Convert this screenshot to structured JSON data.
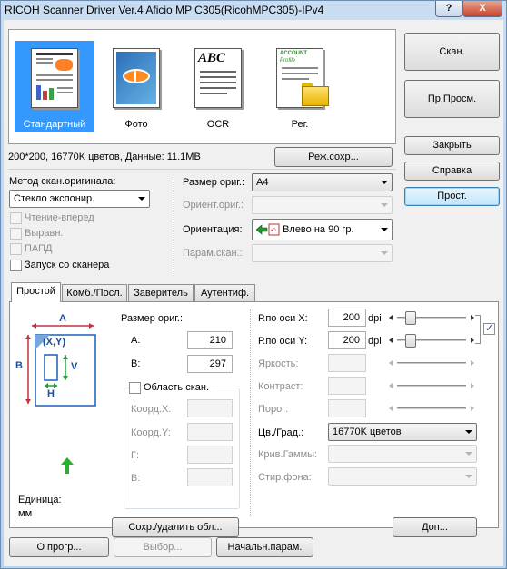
{
  "window": {
    "title": "RICOH Scanner Driver Ver.4 Aficio MP C305(RicohMPC305)-IPv4",
    "help_glyph": "?",
    "close_glyph": "X"
  },
  "presets": [
    {
      "label": "Стандартный",
      "selected": true
    },
    {
      "label": "Фото",
      "selected": false
    },
    {
      "label": "OCR",
      "selected": false
    },
    {
      "label": "Рег.",
      "selected": false
    }
  ],
  "preset_icon_text": {
    "ocr": "ABC",
    "reg_line1": "ACCOUNT",
    "reg_line2": "Profile"
  },
  "info": {
    "status": "200*200, 16770K цветов, Данные: 11.1MB",
    "save_mode_button": "Реж.сохр..."
  },
  "right_buttons": {
    "scan": "Скан.",
    "preview": "Пр.Просм.",
    "close": "Закрыть",
    "help": "Справка",
    "simple": "Прост."
  },
  "scan_method": {
    "label": "Метод скан.оригинала:",
    "value": "Стекло экспонир.",
    "checkboxes": [
      {
        "label": "Чтение-вперед",
        "checked": false,
        "enabled": false
      },
      {
        "label": "Выравн.",
        "checked": false,
        "enabled": false
      },
      {
        "label": "ПАПД",
        "checked": false,
        "enabled": false
      },
      {
        "label": "Запуск со сканера",
        "checked": false,
        "enabled": true
      }
    ]
  },
  "original": {
    "size_label": "Размер ориг.:",
    "size_value": "A4",
    "orient_orig_label": "Ориент.ориг.:",
    "orientation_label": "Ориентация:",
    "orientation_value": "Влево на 90 гр.",
    "scan_param_label": "Парам.скан.:"
  },
  "tabs": [
    {
      "label": "Простой",
      "active": true
    },
    {
      "label": "Комб./Посл.",
      "active": false
    },
    {
      "label": "Заверитель",
      "active": false
    },
    {
      "label": "Аутентиф.",
      "active": false
    }
  ],
  "diagram": {
    "a": "A",
    "b": "B",
    "v": "V",
    "h": "H",
    "xy": "(X,Y)"
  },
  "unit": {
    "label": "Единица:",
    "value": "мм"
  },
  "orig_size": {
    "label": "Размер ориг.:",
    "a_label": "A:",
    "a_value": "210",
    "b_label": "B:",
    "b_value": "297"
  },
  "scan_area": {
    "checkbox_label": "Область скан.",
    "coord_x": "Коорд.X:",
    "coord_y": "Коорд.Y:",
    "g": "Г:",
    "v": "В:",
    "save_delete_button": "Сохр./удалить обл..."
  },
  "resolution": {
    "x_label": "Р.по оси X:",
    "x_value": "200",
    "y_label": "Р.по оси Y:",
    "y_value": "200",
    "unit": "dpi",
    "linked": true
  },
  "adjust": {
    "brightness": "Яркость:",
    "contrast": "Контраст:",
    "threshold": "Порог:"
  },
  "color": {
    "label": "Цв./Град.:",
    "value": "16770K цветов",
    "gamma_label": "Крив.Гаммы:",
    "bg_label": "Стир.фона:",
    "more_button": "Доп..."
  },
  "bottom": {
    "about": "О прогр...",
    "select": "Выбор...",
    "defaults": "Начальн.парам."
  }
}
